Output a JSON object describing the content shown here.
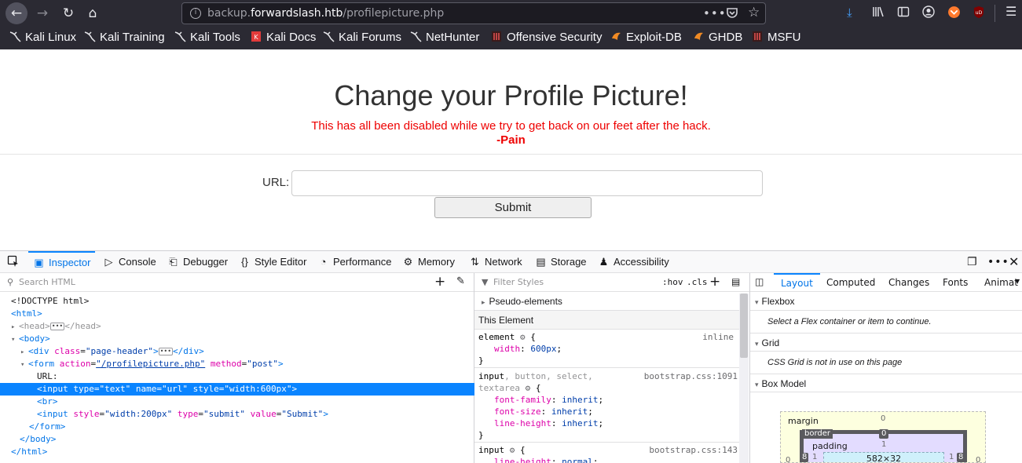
{
  "browser": {
    "url_prefix": "backup.",
    "url_domain": "forwardslash.htb",
    "url_path": "/profilepicture.php",
    "bookmarks": [
      {
        "label": "Kali Linux",
        "icon": "kali-dragon-icon"
      },
      {
        "label": "Kali Training",
        "icon": "kali-dragon-icon"
      },
      {
        "label": "Kali Tools",
        "icon": "kali-dragon-icon"
      },
      {
        "label": "Kali Docs",
        "icon": "kali-docs-icon"
      },
      {
        "label": "Kali Forums",
        "icon": "kali-dragon-icon"
      },
      {
        "label": "NetHunter",
        "icon": "kali-dragon-icon"
      },
      {
        "label": "Offensive Security",
        "icon": "offsec-icon"
      },
      {
        "label": "Exploit-DB",
        "icon": "exploitdb-icon"
      },
      {
        "label": "GHDB",
        "icon": "exploitdb-icon"
      },
      {
        "label": "MSFU",
        "icon": "offsec-icon"
      }
    ]
  },
  "page": {
    "title": "Change your Profile Picture!",
    "warning": "This has all been disabled while we try to get back on our feet after the hack.",
    "signature": "-Pain",
    "url_label": "URL:",
    "url_value": "",
    "submit_label": "Submit"
  },
  "devtools": {
    "tabs": [
      {
        "label": "Inspector",
        "icon": "inspector-icon",
        "active": true
      },
      {
        "label": "Console",
        "icon": "console-icon"
      },
      {
        "label": "Debugger",
        "icon": "debugger-icon"
      },
      {
        "label": "Style Editor",
        "icon": "style-editor-icon"
      },
      {
        "label": "Performance",
        "icon": "performance-icon"
      },
      {
        "label": "Memory",
        "icon": "memory-icon"
      },
      {
        "label": "Network",
        "icon": "network-icon"
      },
      {
        "label": "Storage",
        "icon": "storage-icon"
      },
      {
        "label": "Accessibility",
        "icon": "accessibility-icon"
      }
    ],
    "search_placeholder": "Search HTML",
    "filter_placeholder": "Filter Styles",
    "hov": ":hov",
    "cls": ".cls",
    "layout_tabs": [
      "Layout",
      "Computed",
      "Changes",
      "Fonts",
      "Animat"
    ],
    "html_lines": {
      "doctype": "<!DOCTYPE html>",
      "html_open": "<html>",
      "head": "<head>",
      "head_close": "</head>",
      "body_open": "<body>",
      "div_open": "<div",
      "div_attr": "class",
      "div_val": "\"page-header\"",
      "div_close": "</div>",
      "form_open": "<form",
      "form_attr1": "action",
      "form_val1": "\"/profilepicture.php\"",
      "form_attr2": "method",
      "form_val2": "\"post\"",
      "url_text": "URL:",
      "input_line": "<input type=\"text\" name=\"url\" style=\"width:600px\">",
      "br": "<br>",
      "input2_open": "<input",
      "input2_attr1": "style",
      "input2_val1": "\"width:200px\"",
      "input2_attr2": "type",
      "input2_val2": "\"submit\"",
      "input2_attr3": "value",
      "input2_val3": "\"Submit\"",
      "form_close": "</form>",
      "body_close": "</body>",
      "html_close": "</html>"
    },
    "rules": {
      "pseudo": "Pseudo-elements",
      "this_element": "This Element",
      "r1_selector": "element",
      "r1_source": "inline",
      "r1_prop": "width",
      "r1_val": "600px",
      "r2_selector_a": "input",
      "r2_selector_b": ", button, select,",
      "r2_selector_c": "textarea",
      "r2_source": "bootstrap.css:1091",
      "r2_props": [
        {
          "prop": "font-family",
          "val": "inherit"
        },
        {
          "prop": "font-size",
          "val": "inherit"
        },
        {
          "prop": "line-height",
          "val": "inherit"
        }
      ],
      "r3_selector": "input",
      "r3_source": "bootstrap.css:143",
      "r3_prop": "line-height",
      "r3_val": "normal"
    },
    "layout": {
      "flexbox": "Flexbox",
      "flexbox_msg": "Select a Flex container or item to continue.",
      "grid": "Grid",
      "grid_msg": "CSS Grid is not in use on this page",
      "box_model": "Box Model",
      "margin_label": "margin",
      "border_label": "border",
      "padding_label": "padding",
      "margin_top": "0",
      "border_top": "0",
      "padding_top": "1",
      "content_size": "582×32",
      "side_margin": "0",
      "side_border": "8",
      "side_padding": "1"
    }
  }
}
